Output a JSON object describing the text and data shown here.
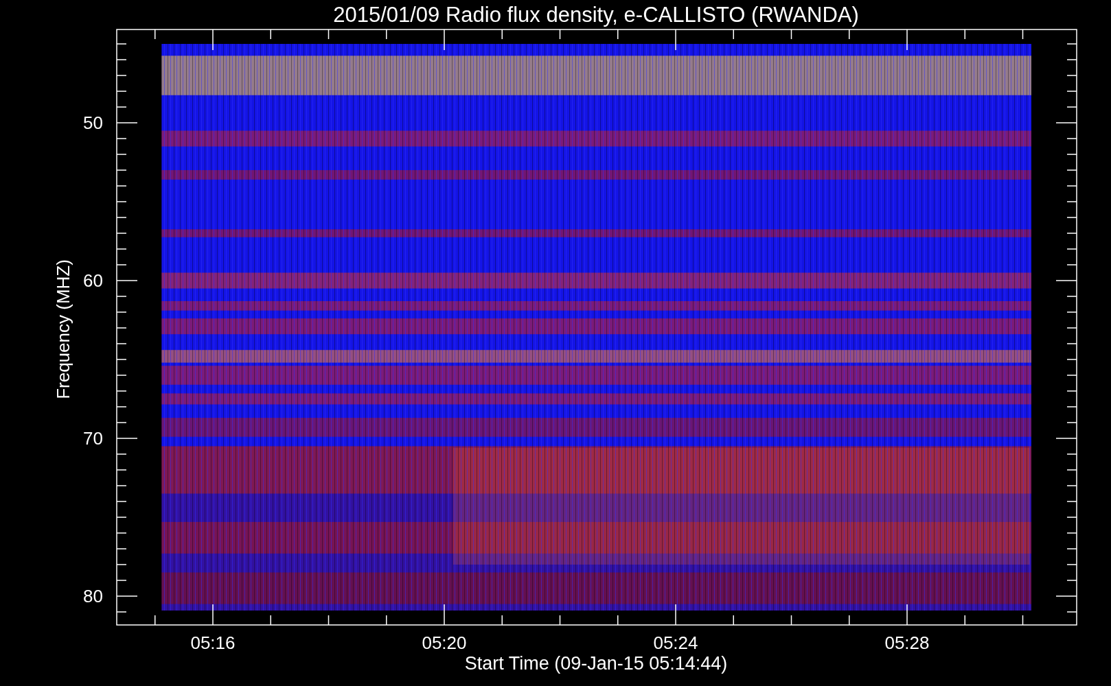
{
  "plot": {
    "title": "2015/01/09  Radio flux density, e-CALLISTO (RWANDA)",
    "ylabel": "Frequency (MHZ)",
    "xlabel": "Start Time (09-Jan-15 05:14:44)",
    "ytick_labels": [
      "50",
      "60",
      "70",
      "80"
    ],
    "xtick_labels": [
      "05:16",
      "05:20",
      "05:24",
      "05:28"
    ]
  }
}
